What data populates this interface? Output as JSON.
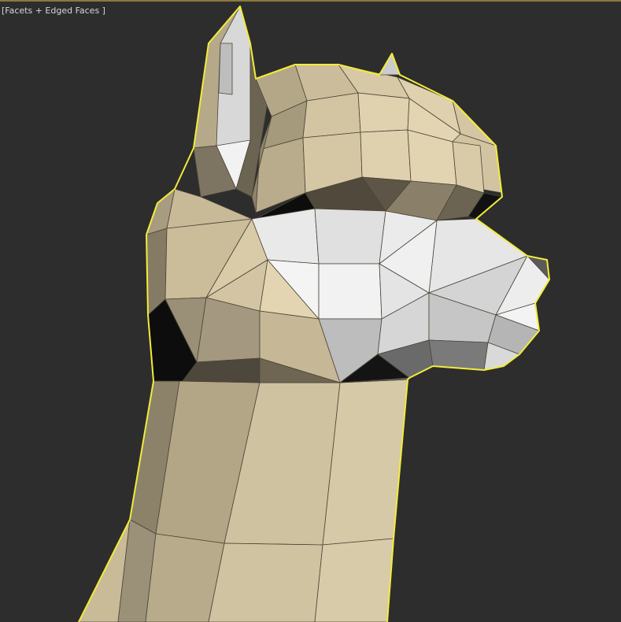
{
  "viewport": {
    "label": "[Facets + Edged Faces ]",
    "background": "#2d2d2d",
    "selection_color": "#f2ec3a"
  },
  "model": {
    "object": "alpaca-head",
    "shading": "Facets + Edged Faces",
    "selected": true
  }
}
